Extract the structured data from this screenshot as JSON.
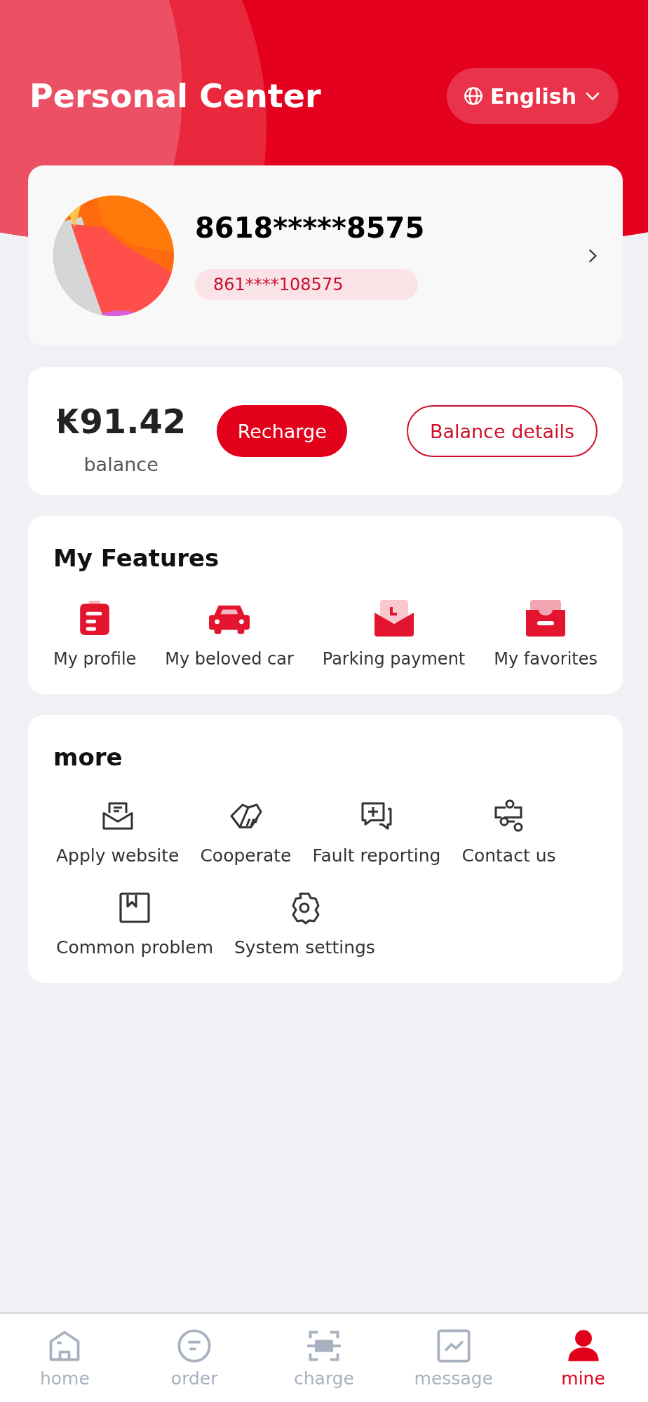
{
  "header": {
    "title": "Personal Center",
    "language": {
      "label": "English"
    }
  },
  "profile": {
    "name": "8618*****8575",
    "account": "861****108575"
  },
  "balance": {
    "amount": "₭91.42",
    "label": "balance",
    "buttons": [
      "Recharge",
      "Balance details"
    ]
  },
  "features": {
    "title": "My Features",
    "items": [
      {
        "label": "My profile"
      },
      {
        "label": "My beloved car"
      },
      {
        "label": "Parking payment"
      },
      {
        "label": "My favorites"
      }
    ]
  },
  "more": {
    "title": "more",
    "items": [
      {
        "label": "Apply website"
      },
      {
        "label": "Cooperate"
      },
      {
        "label": "Fault reporting"
      },
      {
        "label": "Contact us"
      },
      {
        "label": "Common problem"
      },
      {
        "label": "System settings"
      }
    ]
  },
  "tab_bar": [
    {
      "label": "home",
      "selected": false
    },
    {
      "label": "order",
      "selected": false
    },
    {
      "label": "charge",
      "selected": false
    },
    {
      "label": "message",
      "selected": false
    },
    {
      "label": "mine",
      "selected": true
    }
  ]
}
